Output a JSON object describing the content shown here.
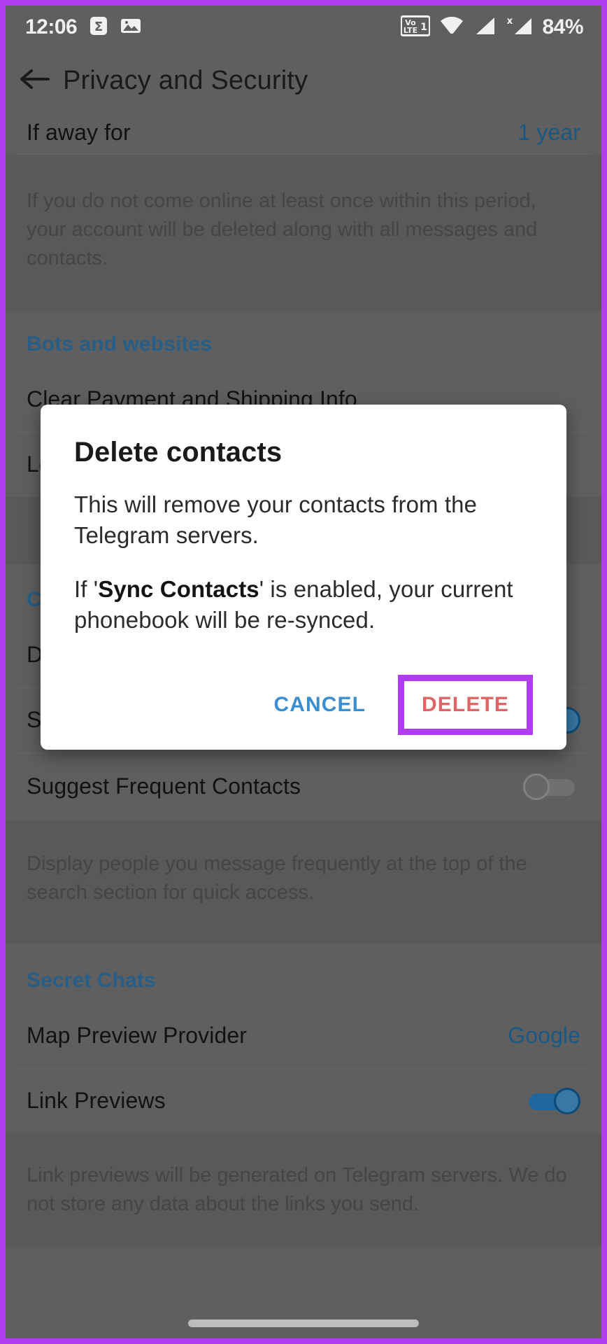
{
  "status_bar": {
    "time": "12:06",
    "battery": "84%",
    "left_icons": [
      "sigma-notification-icon",
      "photo-notification-icon"
    ],
    "right_icons": [
      "volte-1-icon",
      "wifi-icon",
      "signal-bars-icon",
      "signal-no-data-icon"
    ]
  },
  "app_bar": {
    "back_icon": "back-arrow-icon",
    "title": "Privacy and Security"
  },
  "settings": {
    "away_row": {
      "label": "If away for",
      "value": "1 year"
    },
    "away_note": "If you do not come online at least once within this period, your account will be deleted along with all messages and contacts.",
    "bots_section": "Bots and websites",
    "clear_payment": "Clear Payment and Shipping Info",
    "logged_in_telegram": "Logged In with Telegram",
    "contacts_section": "Contacts",
    "delete_synced_contacts": "Delete Synced Contacts",
    "sync_contacts": "Sync Contacts",
    "suggest_frequent_contacts": "Suggest Frequent Contacts",
    "suggest_note": "Display people you message frequently at the top of the search section for quick access.",
    "secret_section": "Secret Chats",
    "map_preview_row": {
      "label": "Map Preview Provider",
      "value": "Google"
    },
    "link_previews_row": {
      "label": "Link Previews"
    },
    "link_previews_note": "Link previews will be generated on Telegram servers. We do not store any data about the links you send."
  },
  "dialog": {
    "title": "Delete contacts",
    "paragraph_1": "This will remove your contacts from the Telegram servers.",
    "paragraph_2_prefix": "If '",
    "paragraph_2_bold": "Sync Contacts",
    "paragraph_2_suffix": "' is enabled, your current phonebook will be re-synced.",
    "cancel_label": "CANCEL",
    "delete_label": "DELETE"
  },
  "colors": {
    "highlight": "#b03ef0",
    "accent_blue": "#3b8ed0",
    "destructive_red": "#dd6565",
    "section_header": "#2a6490",
    "screen_bg": "#656565"
  }
}
